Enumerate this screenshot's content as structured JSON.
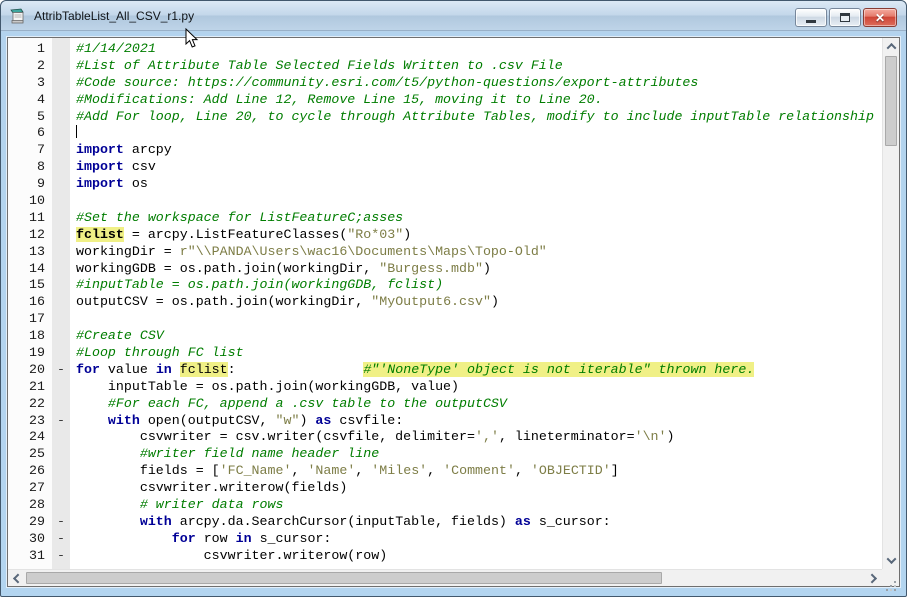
{
  "window": {
    "title": "AttribTableList_All_CSV_r1.py",
    "icon": "script-document-icon",
    "controls": {
      "minimize": "minimize",
      "maximize": "maximize",
      "close": "close"
    }
  },
  "colors": {
    "keyword": "#000096",
    "comment": "#007d00",
    "string": "#7d7d46",
    "find_highlight": "#f0f086",
    "titlebar": "#c3d7ea",
    "close_button": "#ce4334"
  },
  "editor": {
    "lines": [
      {
        "n": 1,
        "fold": false,
        "seg": [
          [
            "c",
            "#1/14/2021"
          ]
        ]
      },
      {
        "n": 2,
        "fold": false,
        "seg": [
          [
            "c",
            "#List of Attribute Table Selected Fields Written to .csv File"
          ]
        ]
      },
      {
        "n": 3,
        "fold": false,
        "seg": [
          [
            "c",
            "#Code source: https://community.esri.com/t5/python-questions/export-attributes"
          ]
        ]
      },
      {
        "n": 4,
        "fold": false,
        "seg": [
          [
            "c",
            "#Modifications: Add Line 12, Remove Line 15, moving it to Line 20."
          ]
        ]
      },
      {
        "n": 5,
        "fold": false,
        "seg": [
          [
            "c",
            "#Add For loop, Line 20, to cycle through Attribute Tables, modify to include inputTable relationship"
          ]
        ]
      },
      {
        "n": 6,
        "fold": false,
        "seg": [
          [
            "caret",
            ""
          ]
        ]
      },
      {
        "n": 7,
        "fold": false,
        "seg": [
          [
            "k",
            "import"
          ],
          [
            "n",
            " arcpy"
          ]
        ]
      },
      {
        "n": 8,
        "fold": false,
        "seg": [
          [
            "k",
            "import"
          ],
          [
            "n",
            " csv"
          ]
        ]
      },
      {
        "n": 9,
        "fold": false,
        "seg": [
          [
            "k",
            "import"
          ],
          [
            "n",
            " os"
          ]
        ]
      },
      {
        "n": 10,
        "fold": false,
        "seg": []
      },
      {
        "n": 11,
        "fold": false,
        "seg": [
          [
            "c",
            "#Set the workspace for ListFeatureC;asses"
          ]
        ]
      },
      {
        "n": 12,
        "fold": false,
        "seg": [
          [
            "hlb",
            "fclist"
          ],
          [
            "n",
            " = arcpy.ListFeatureClasses("
          ],
          [
            "s",
            "\"Ro*03\""
          ],
          [
            "n",
            ")"
          ]
        ]
      },
      {
        "n": 13,
        "fold": false,
        "seg": [
          [
            "n",
            "workingDir = "
          ],
          [
            "s",
            "r\"\\\\PANDA\\Users\\wac16\\Documents\\Maps\\Topo-Old\""
          ]
        ]
      },
      {
        "n": 14,
        "fold": false,
        "seg": [
          [
            "n",
            "workingGDB = os.path.join(workingDir, "
          ],
          [
            "s",
            "\"Burgess.mdb\""
          ],
          [
            "n",
            ")"
          ]
        ]
      },
      {
        "n": 15,
        "fold": false,
        "seg": [
          [
            "c",
            "#inputTable = os.path.join(workingGDB, fclist)"
          ]
        ]
      },
      {
        "n": 16,
        "fold": false,
        "seg": [
          [
            "n",
            "outputCSV = os.path.join(workingDir, "
          ],
          [
            "s",
            "\"MyOutput6.csv\""
          ],
          [
            "n",
            ")"
          ]
        ]
      },
      {
        "n": 17,
        "fold": false,
        "seg": []
      },
      {
        "n": 18,
        "fold": false,
        "seg": [
          [
            "c",
            "#Create CSV"
          ]
        ]
      },
      {
        "n": 19,
        "fold": false,
        "seg": [
          [
            "c",
            "#Loop through FC list"
          ]
        ]
      },
      {
        "n": 20,
        "fold": true,
        "seg": [
          [
            "k",
            "for"
          ],
          [
            "n",
            " value "
          ],
          [
            "k",
            "in"
          ],
          [
            "n",
            " "
          ],
          [
            "hl",
            "fclist"
          ],
          [
            "n",
            ":                "
          ],
          [
            "chl",
            "#\"'NoneType' object is not iterable\" thrown here."
          ]
        ]
      },
      {
        "n": 21,
        "fold": false,
        "seg": [
          [
            "n",
            "    inputTable = os.path.join(workingGDB, value)"
          ]
        ]
      },
      {
        "n": 22,
        "fold": false,
        "seg": [
          [
            "n",
            "    "
          ],
          [
            "c",
            "#For each FC, append a .csv table to the outputCSV"
          ]
        ]
      },
      {
        "n": 23,
        "fold": true,
        "seg": [
          [
            "n",
            "    "
          ],
          [
            "k",
            "with"
          ],
          [
            "n",
            " open(outputCSV, "
          ],
          [
            "s",
            "\"w\""
          ],
          [
            "n",
            ") "
          ],
          [
            "k",
            "as"
          ],
          [
            "n",
            " csvfile:"
          ]
        ]
      },
      {
        "n": 24,
        "fold": false,
        "seg": [
          [
            "n",
            "        csvwriter = csv.writer(csvfile, delimiter="
          ],
          [
            "s",
            "','"
          ],
          [
            "n",
            ", lineterminator="
          ],
          [
            "s",
            "'\\n'"
          ],
          [
            "n",
            ")"
          ]
        ]
      },
      {
        "n": 25,
        "fold": false,
        "seg": [
          [
            "n",
            "        "
          ],
          [
            "c",
            "#writer field name header line"
          ]
        ]
      },
      {
        "n": 26,
        "fold": false,
        "seg": [
          [
            "n",
            "        fields = ["
          ],
          [
            "s",
            "'FC_Name'"
          ],
          [
            "n",
            ", "
          ],
          [
            "s",
            "'Name'"
          ],
          [
            "n",
            ", "
          ],
          [
            "s",
            "'Miles'"
          ],
          [
            "n",
            ", "
          ],
          [
            "s",
            "'Comment'"
          ],
          [
            "n",
            ", "
          ],
          [
            "s",
            "'OBJECTID'"
          ],
          [
            "n",
            "]"
          ]
        ]
      },
      {
        "n": 27,
        "fold": false,
        "seg": [
          [
            "n",
            "        csvwriter.writerow(fields)"
          ]
        ]
      },
      {
        "n": 28,
        "fold": false,
        "seg": [
          [
            "n",
            "        "
          ],
          [
            "c",
            "# writer data rows"
          ]
        ]
      },
      {
        "n": 29,
        "fold": true,
        "seg": [
          [
            "n",
            "        "
          ],
          [
            "k",
            "with"
          ],
          [
            "n",
            " arcpy.da.SearchCursor(inputTable, fields) "
          ],
          [
            "k",
            "as"
          ],
          [
            "n",
            " s_cursor:"
          ]
        ]
      },
      {
        "n": 30,
        "fold": true,
        "seg": [
          [
            "n",
            "            "
          ],
          [
            "k",
            "for"
          ],
          [
            "n",
            " row "
          ],
          [
            "k",
            "in"
          ],
          [
            "n",
            " s_cursor:"
          ]
        ]
      },
      {
        "n": 31,
        "fold": true,
        "seg": [
          [
            "n",
            "                csvwriter.writerow(row)"
          ]
        ]
      }
    ]
  }
}
